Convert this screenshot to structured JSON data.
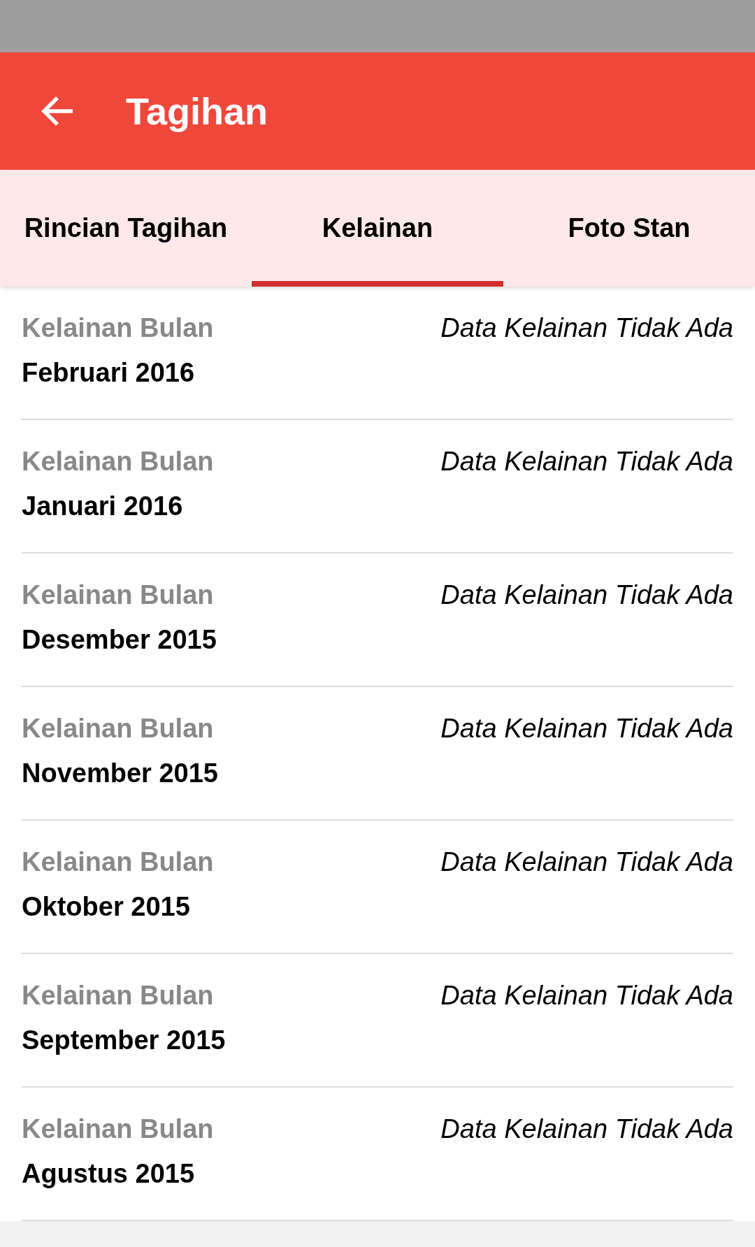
{
  "app_bar": {
    "title": "Tagihan"
  },
  "tabs": [
    {
      "label": "Rincian Tagihan",
      "selected": false
    },
    {
      "label": "Kelainan",
      "selected": true
    },
    {
      "label": "Foto Stan",
      "selected": false
    }
  ],
  "rows": [
    {
      "label": "Kelainan Bulan",
      "month": "Februari 2016",
      "status": "Data Kelainan Tidak Ada"
    },
    {
      "label": "Kelainan Bulan",
      "month": "Januari 2016",
      "status": "Data Kelainan Tidak Ada"
    },
    {
      "label": "Kelainan Bulan",
      "month": "Desember 2015",
      "status": "Data Kelainan Tidak Ada"
    },
    {
      "label": "Kelainan Bulan",
      "month": "November 2015",
      "status": "Data Kelainan Tidak Ada"
    },
    {
      "label": "Kelainan Bulan",
      "month": "Oktober 2015",
      "status": "Data Kelainan Tidak Ada"
    },
    {
      "label": "Kelainan Bulan",
      "month": "September 2015",
      "status": "Data Kelainan Tidak Ada"
    },
    {
      "label": "Kelainan Bulan",
      "month": "Agustus 2015",
      "status": "Data Kelainan Tidak Ada"
    }
  ]
}
